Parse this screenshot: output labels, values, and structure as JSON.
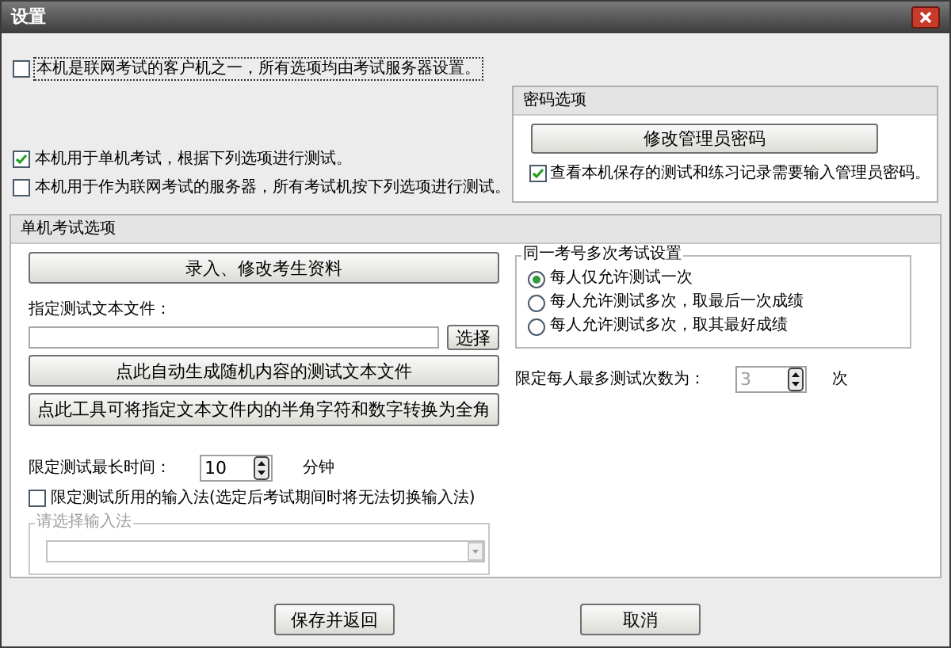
{
  "window": {
    "title": "设置"
  },
  "client_option": {
    "label": "本机是联网考试的客户机之一，所有选项均由考试服务器设置。",
    "checked": false
  },
  "mode_options": [
    {
      "label": "本机用于单机考试，根据下列选项进行测试。",
      "checked": true
    },
    {
      "label": "本机用于作为联网考试的服务器，所有考试机按下列选项进行测试。",
      "checked": false
    }
  ],
  "password_panel": {
    "title": "密码选项",
    "button": "修改管理员密码",
    "require_password": {
      "label": "查看本机保存的测试和练习记录需要输入管理员密码。",
      "checked": true
    }
  },
  "standalone_panel": {
    "title": "单机考试选项",
    "edit_button": "录入、修改考生资料",
    "file_label": "指定测试文本文件：",
    "browse_button": "选择",
    "generate_button": "点此自动生成随机内容的测试文本文件",
    "convert_button": "点此工具可将指定文本文件内的半角字符和数字转换为全角",
    "retake": {
      "title": "同一考号多次考试设置",
      "options": [
        {
          "label": "每人仅允许测试一次",
          "selected": true
        },
        {
          "label": "每人允许测试多次，取最后一次成绩",
          "selected": false
        },
        {
          "label": "每人允许测试多次，取其最好成绩",
          "selected": false
        }
      ]
    },
    "max_attempts": {
      "label": "限定每人最多测试次数为：",
      "value": "3",
      "disabled": true,
      "unit": "次"
    },
    "time_limit": {
      "label": "限定测试最长时间：",
      "value": "10",
      "disabled": false,
      "unit": "分钟"
    },
    "ime_limit": {
      "label": "限定测试所用的输入法(选定后考试期间时将无法切换输入法)",
      "checked": false
    },
    "ime_group": {
      "title": "请选择输入法",
      "disabled": true
    }
  },
  "buttons": [
    "保存并返回",
    "取消"
  ]
}
